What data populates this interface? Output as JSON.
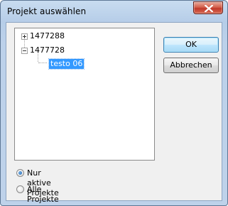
{
  "window": {
    "title": "Projekt auswählen"
  },
  "tree": {
    "nodes": [
      {
        "label": "1477288",
        "expanded": false
      },
      {
        "label": "1477728",
        "expanded": true,
        "children": [
          {
            "label": "testo 06",
            "selected": true
          }
        ]
      }
    ]
  },
  "buttons": {
    "ok": "OK",
    "cancel": "Abbrechen"
  },
  "filter": {
    "active_only": "Nur aktive Projekte",
    "all": "Alle Projekte",
    "selected": "active_only"
  },
  "colors": {
    "selection": "#3399ff",
    "close_button": "#c0392b",
    "frame": "#bcd1ea"
  }
}
